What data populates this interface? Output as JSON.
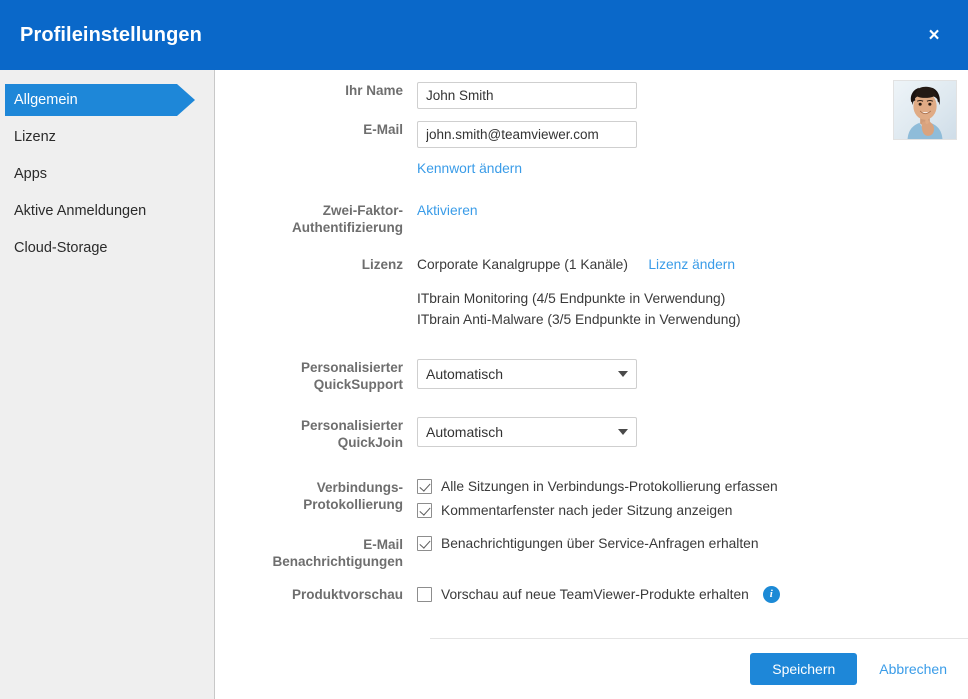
{
  "window": {
    "title": "Profileinstellungen",
    "close_label": "×",
    "header_color": "#0a68c9",
    "accent_color": "#1e87d8",
    "link_color": "#3a9ce8"
  },
  "sidebar": {
    "items": [
      {
        "label": "Allgemein",
        "active": true
      },
      {
        "label": "Lizenz",
        "active": false
      },
      {
        "label": "Apps",
        "active": false
      },
      {
        "label": "Aktive Anmeldungen",
        "active": false
      },
      {
        "label": "Cloud-Storage",
        "active": false
      }
    ]
  },
  "avatar": {
    "alt": "profile-photo"
  },
  "form": {
    "name": {
      "label": "Ihr Name",
      "value": "John Smith",
      "placeholder": "Ihr Name"
    },
    "email": {
      "label": "E-Mail",
      "value": "john.smith@teamviewer.com",
      "placeholder": "E-Mail"
    },
    "change_password_link": "Kennwort ändern",
    "two_factor": {
      "label_line1": "Zwei-Faktor-",
      "label_line2": "Authentifizierung",
      "activate_link": "Aktivieren"
    },
    "license": {
      "label": "Lizenz",
      "value": "Corporate Kanalgruppe (1 Kanäle)",
      "change_link": "Lizenz ändern",
      "details": [
        "ITbrain Monitoring (4/5 Endpunkte in Verwendung)",
        "ITbrain Anti-Malware (3/5 Endpunkte in Verwendung)"
      ]
    },
    "quicksupport": {
      "label_line1": "Personalisierter",
      "label_line2": "QuickSupport",
      "value": "Automatisch",
      "options": [
        "Automatisch"
      ]
    },
    "quickjoin": {
      "label_line1": "Personalisierter",
      "label_line2": "QuickJoin",
      "value": "Automatisch",
      "options": [
        "Automatisch"
      ]
    },
    "connection_log": {
      "label_line1": "Verbindungs-",
      "label_line2": "Protokollierung",
      "checkboxes": [
        {
          "label": "Alle Sitzungen in Verbindungs-Protokollierung erfassen",
          "checked": true
        },
        {
          "label": "Kommentarfenster nach jeder Sitzung anzeigen",
          "checked": true
        }
      ]
    },
    "email_notifications": {
      "label_line1": "E-Mail",
      "label_line2": "Benachrichtigungen",
      "checkboxes": [
        {
          "label": "Benachrichtigungen über Service-Anfragen erhalten",
          "checked": true
        }
      ]
    },
    "product_preview": {
      "label": "Produktvorschau",
      "checkbox": {
        "label": "Vorschau auf neue TeamViewer-Produkte erhalten",
        "checked": false
      },
      "info_icon_label": "i"
    }
  },
  "footer": {
    "save_label": "Speichern",
    "cancel_label": "Abbrechen"
  }
}
